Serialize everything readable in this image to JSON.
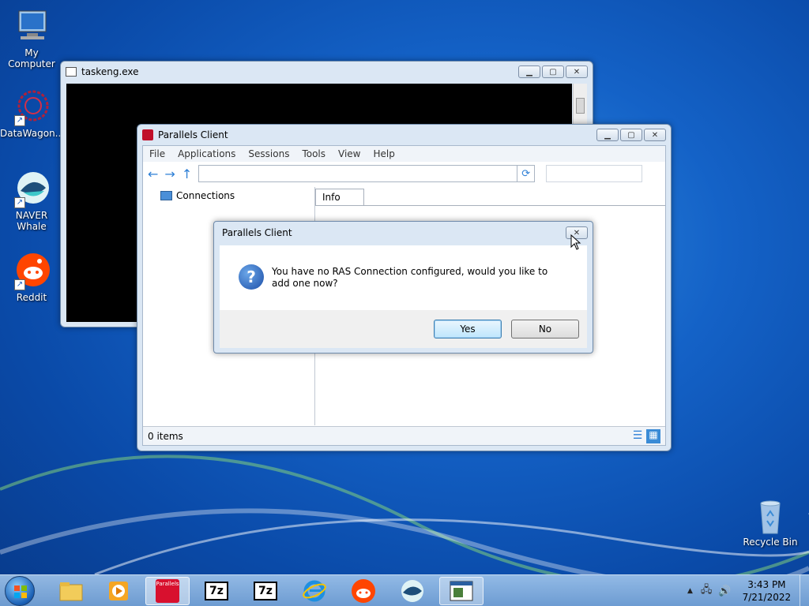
{
  "desktop": {
    "icons": [
      {
        "label": "My Computer"
      },
      {
        "label": "DataWagon..."
      },
      {
        "label": "NAVER Whale"
      },
      {
        "label": "Reddit"
      },
      {
        "label": "Recycle Bin"
      }
    ]
  },
  "taskeng": {
    "title": "taskeng.exe"
  },
  "parallels": {
    "title": "Parallels Client",
    "menu": [
      "File",
      "Applications",
      "Sessions",
      "Tools",
      "View",
      "Help"
    ],
    "tree_root": "Connections",
    "tab_info": "Info",
    "status": "0 items"
  },
  "dialog": {
    "title": "Parallels Client",
    "message": "You have no RAS Connection configured, would you like to add one now?",
    "yes": "Yes",
    "no": "No"
  },
  "taskbar": {
    "time": "3:43 PM",
    "date": "7/21/2022",
    "parallels_label": "Parallels",
    "sevenzip_label": "7z"
  }
}
